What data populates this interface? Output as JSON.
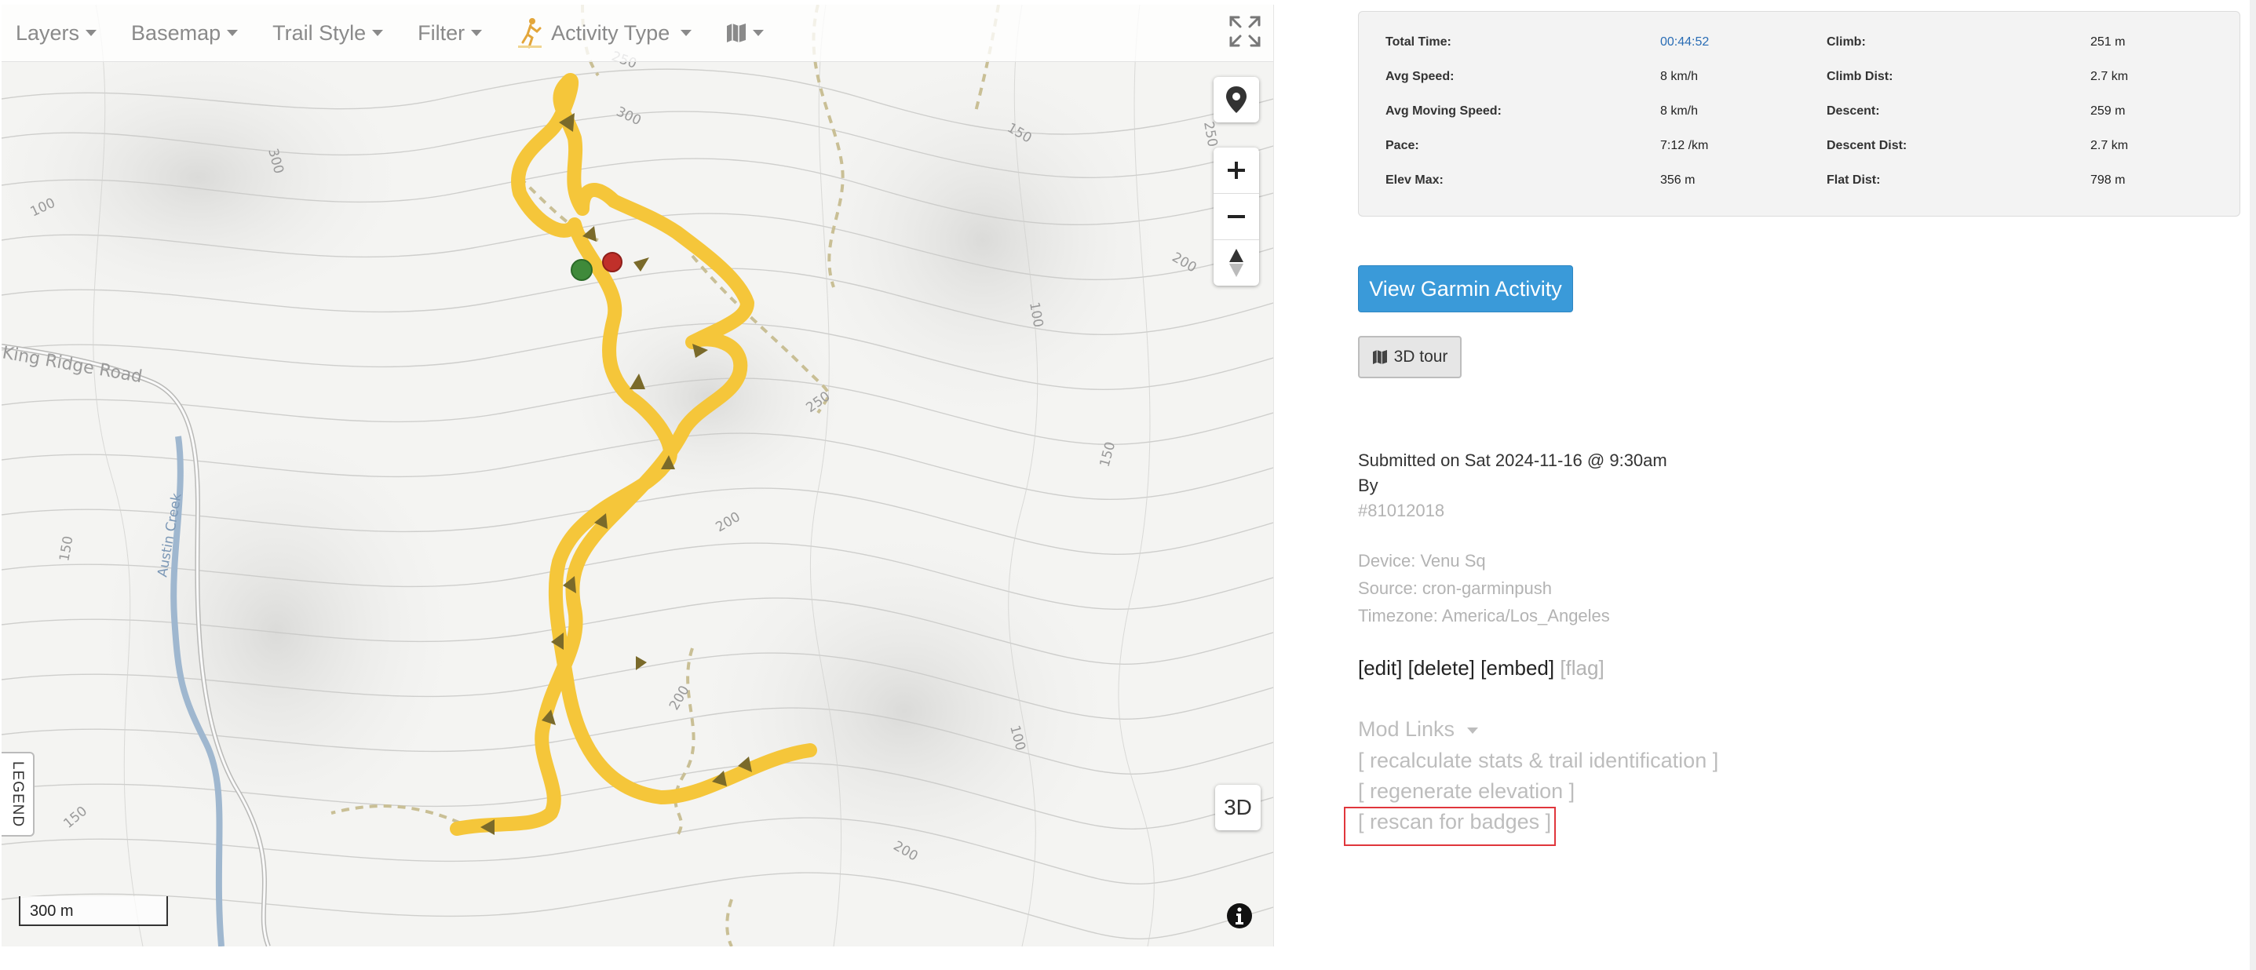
{
  "toolbar": {
    "layers": "Layers",
    "basemap": "Basemap",
    "trail_style": "Trail Style",
    "filter": "Filter",
    "activity_type": "Activity Type"
  },
  "map": {
    "road_label": "King Ridge Road",
    "creek_label": "Austin Creek",
    "contours": [
      "250",
      "300",
      "300",
      "100",
      "150",
      "200",
      "100",
      "250",
      "150",
      "200",
      "150",
      "250",
      "200",
      "100",
      "150",
      "200"
    ],
    "legend": "LEGEND",
    "btn_3d": "3D",
    "scale": "300 m",
    "track_color": "#f5c63a",
    "start_color": "#3f8a3a",
    "end_color": "#c0302a"
  },
  "stats": {
    "total_time_label": "Total Time:",
    "total_time": "00:44:52",
    "avg_speed_label": "Avg Speed:",
    "avg_speed": "8 km/h",
    "avg_moving_label": "Avg Moving Speed:",
    "avg_moving": "8 km/h",
    "pace_label": "Pace:",
    "pace": "7:12 /km",
    "elev_max_label": "Elev Max:",
    "elev_max": "356 m",
    "climb_label": "Climb:",
    "climb": "251 m",
    "climb_dist_label": "Climb Dist:",
    "climb_dist": "2.7 km",
    "descent_label": "Descent:",
    "descent": "259 m",
    "descent_dist_label": "Descent Dist:",
    "descent_dist": "2.7 km",
    "flat_dist_label": "Flat Dist:",
    "flat_dist": "798 m"
  },
  "buttons": {
    "garmin": "View Garmin Activity",
    "tour": "3D tour"
  },
  "meta": {
    "submitted": "Submitted on Sat 2024-11-16 @ 9:30am",
    "by": "By",
    "id": "#81012018",
    "device": "Device: Venu Sq",
    "source": "Source: cron-garminpush",
    "timezone": "Timezone: America/Los_Angeles"
  },
  "actions": {
    "edit": "[edit]",
    "delete": "[delete]",
    "embed": "[embed]",
    "flag": "[flag]"
  },
  "mod": {
    "title": "Mod Links",
    "recalc": "[ recalculate stats & trail identification ]",
    "regen": "[ regenerate elevation ]",
    "rescan": "[ rescan for badges ]"
  },
  "colors": {
    "accent": "#3a9ad9",
    "highlight": "#e0363c"
  }
}
